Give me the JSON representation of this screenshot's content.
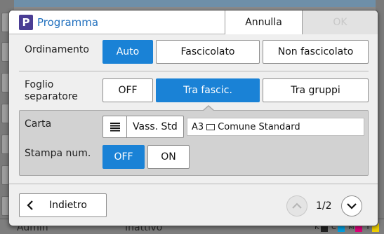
{
  "background": {
    "status_user": "Admin",
    "status_state": "Inattivo",
    "ink_labels": [
      "K",
      "C",
      "M",
      "Y"
    ],
    "ink_colors": [
      "#222222",
      "#00a0e0",
      "#e0007a",
      "#f0d000"
    ]
  },
  "dialog": {
    "title": "Programma",
    "cancel_label": "Annulla",
    "ok_label": "OK"
  },
  "sort": {
    "label": "Ordinamento",
    "options": [
      "Auto",
      "Fascicolato",
      "Non fascicolato"
    ],
    "selected": "Auto"
  },
  "separator": {
    "label_line1": "Foglio",
    "label_line2": "separatore",
    "options": [
      "OFF",
      "Tra fascic.",
      "Tra gruppi"
    ],
    "selected": "Tra fascic."
  },
  "paper": {
    "label": "Carta",
    "tray_label": "Vass. Std",
    "size": "A3",
    "type": "Comune Standard"
  },
  "print_number": {
    "label": "Stampa num.",
    "options": [
      "OFF",
      "ON"
    ],
    "selected": "OFF"
  },
  "footer": {
    "back_label": "Indietro",
    "page_indicator": "1/2"
  },
  "colors": {
    "accent": "#1a82d6",
    "title": "#1e6ebd",
    "brand_icon": "#4a3d94"
  },
  "icons": {
    "brand": "p-program-icon",
    "tray": "paper-tray-icon",
    "sheet": "paper-sheet-icon",
    "back": "chevron-left-icon",
    "up": "chevron-up-icon",
    "down": "chevron-down-icon"
  }
}
